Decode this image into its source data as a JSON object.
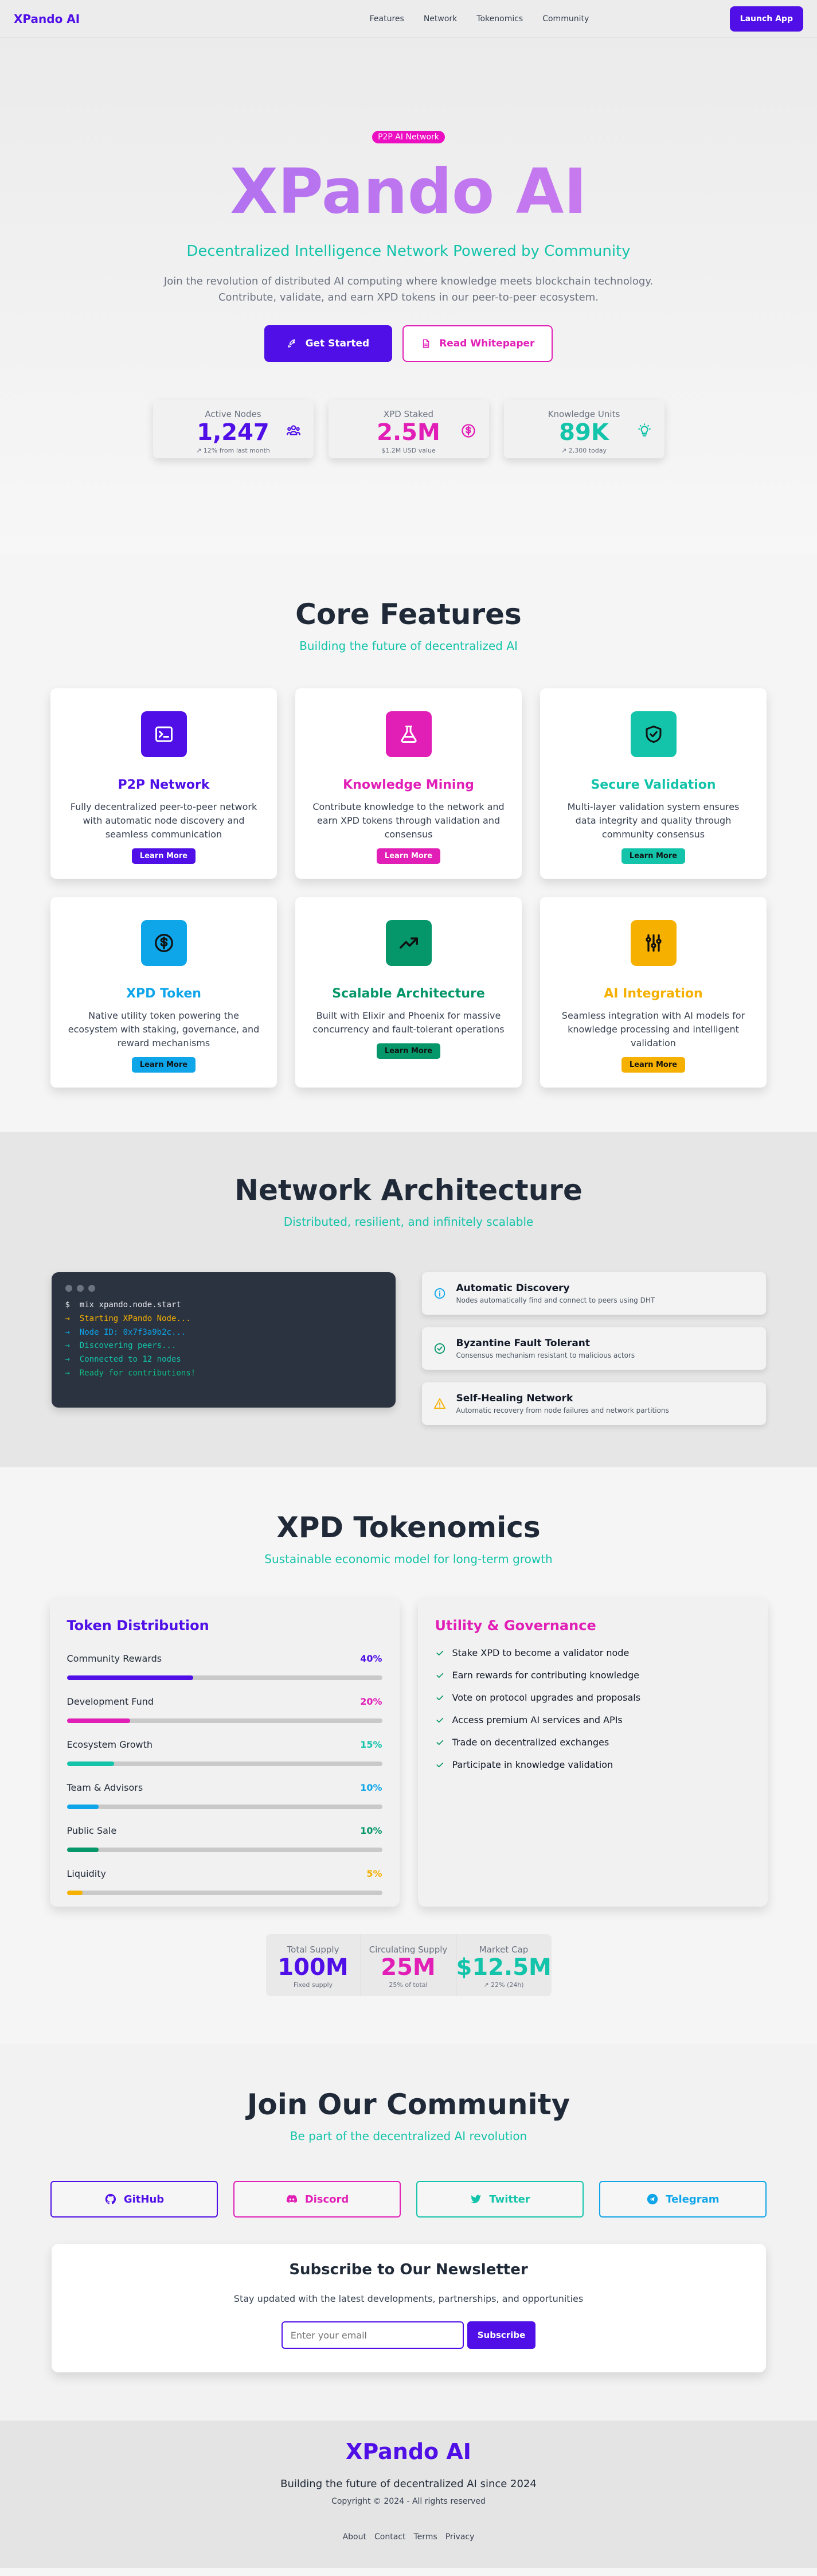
{
  "colors": {
    "primary": "#4f0fe6",
    "magenta": "#e11eb6",
    "teal": "#14c4aa",
    "sky": "#0ea5e9",
    "green": "#059669",
    "amber": "#f5b000"
  },
  "nav": {
    "brand": "XPando AI",
    "links": [
      "Features",
      "Network",
      "Tokenomics",
      "Community"
    ],
    "launch_label": "Launch App"
  },
  "hero": {
    "badge": "P2P AI Network",
    "title": "XPando AI",
    "subtitle": "Decentralized Intelligence Network Powered by Community",
    "description_line1": "Join the revolution of distributed AI computing where knowledge meets blockchain technology.",
    "description_line2": "Contribute, validate, and earn XPD tokens in our peer-to-peer ecosystem.",
    "primary_button": "Get Started",
    "secondary_button": "Read Whitepaper",
    "stats": [
      {
        "label": "Active Nodes",
        "value": "1,247",
        "sub": "↗ 12% from last month",
        "icon": "users-icon"
      },
      {
        "label": "XPD Staked",
        "value": "2.5M",
        "sub": "$1.2M USD value",
        "icon": "dollar-circle-icon"
      },
      {
        "label": "Knowledge Units",
        "value": "89K",
        "sub": "↗ 2,300 today",
        "icon": "lightbulb-icon"
      }
    ]
  },
  "features": {
    "title": "Core Features",
    "subtitle": "Building the future of decentralized AI",
    "learn_more": "Learn More",
    "items": [
      {
        "title": "P2P Network",
        "desc": "Fully decentralized peer-to-peer network with automatic node discovery and seamless communication",
        "icon": "terminal-icon"
      },
      {
        "title": "Knowledge Mining",
        "desc": "Contribute knowledge to the network and earn XPD tokens through validation and consensus",
        "icon": "flask-icon"
      },
      {
        "title": "Secure Validation",
        "desc": "Multi-layer validation system ensures data integrity and quality through community consensus",
        "icon": "shield-check-icon"
      },
      {
        "title": "XPD Token",
        "desc": "Native utility token powering the ecosystem with staking, governance, and reward mechanisms",
        "icon": "dollar-circle-icon"
      },
      {
        "title": "Scalable Architecture",
        "desc": "Built with Elixir and Phoenix for massive concurrency and fault-tolerant operations",
        "icon": "trending-up-icon"
      },
      {
        "title": "AI Integration",
        "desc": "Seamless integration with AI models for knowledge processing and intelligent validation",
        "icon": "sliders-icon"
      }
    ]
  },
  "network": {
    "title": "Network Architecture",
    "subtitle": "Distributed, resilient, and infinitely scalable",
    "terminal": [
      {
        "prefix": "$",
        "text": "mix xpando.node.start"
      },
      {
        "prefix": "→",
        "text": "Starting XPando Node..."
      },
      {
        "prefix": "→",
        "text": "Node ID: 0x7f3a9b2c..."
      },
      {
        "prefix": "→",
        "text": "Discovering peers..."
      },
      {
        "prefix": "→",
        "text": "Connected to 12 nodes"
      },
      {
        "prefix": "→",
        "text": "Ready for contributions!"
      }
    ],
    "items": [
      {
        "title": "Automatic Discovery",
        "desc": "Nodes automatically find and connect to peers using DHT",
        "icon": "info-circle-icon"
      },
      {
        "title": "Byzantine Fault Tolerant",
        "desc": "Consensus mechanism resistant to malicious actors",
        "icon": "check-circle-icon"
      },
      {
        "title": "Self-Healing Network",
        "desc": "Automatic recovery from node failures and network partitions",
        "icon": "warning-icon"
      }
    ]
  },
  "tokenomics": {
    "title": "XPD Tokenomics",
    "subtitle": "Sustainable economic model for long-term growth",
    "distribution_title": "Token Distribution",
    "distribution": [
      {
        "label": "Community Rewards",
        "pct": "40%",
        "value": 40
      },
      {
        "label": "Development Fund",
        "pct": "20%",
        "value": 20
      },
      {
        "label": "Ecosystem Growth",
        "pct": "15%",
        "value": 15
      },
      {
        "label": "Team & Advisors",
        "pct": "10%",
        "value": 10
      },
      {
        "label": "Public Sale",
        "pct": "10%",
        "value": 10
      },
      {
        "label": "Liquidity",
        "pct": "5%",
        "value": 5
      }
    ],
    "utility_title": "Utility & Governance",
    "utility": [
      "Stake XPD to become a validator node",
      "Earn rewards for contributing knowledge",
      "Vote on protocol upgrades and proposals",
      "Access premium AI services and APIs",
      "Trade on decentralized exchanges",
      "Participate in knowledge validation"
    ],
    "supply": [
      {
        "label": "Total Supply",
        "value": "100M",
        "sub": "Fixed supply"
      },
      {
        "label": "Circulating Supply",
        "value": "25M",
        "sub": "25% of total"
      },
      {
        "label": "Market Cap",
        "value": "$12.5M",
        "sub": "↗ 22% (24h)"
      }
    ]
  },
  "community": {
    "title": "Join Our Community",
    "subtitle": "Be part of the decentralized AI revolution",
    "socials": [
      {
        "label": "GitHub",
        "icon": "github-icon"
      },
      {
        "label": "Discord",
        "icon": "discord-icon"
      },
      {
        "label": "Twitter",
        "icon": "twitter-icon"
      },
      {
        "label": "Telegram",
        "icon": "telegram-icon"
      }
    ],
    "newsletter": {
      "title": "Subscribe to Our Newsletter",
      "desc": "Stay updated with the latest developments, partnerships, and opportunities",
      "placeholder": "Enter your email",
      "button": "Subscribe"
    }
  },
  "footer": {
    "brand": "XPando AI",
    "tagline": "Building the future of decentralized AI since 2024",
    "copyright": "Copyright © 2024 - All rights reserved",
    "links": [
      "About",
      "Contact",
      "Terms",
      "Privacy"
    ]
  }
}
